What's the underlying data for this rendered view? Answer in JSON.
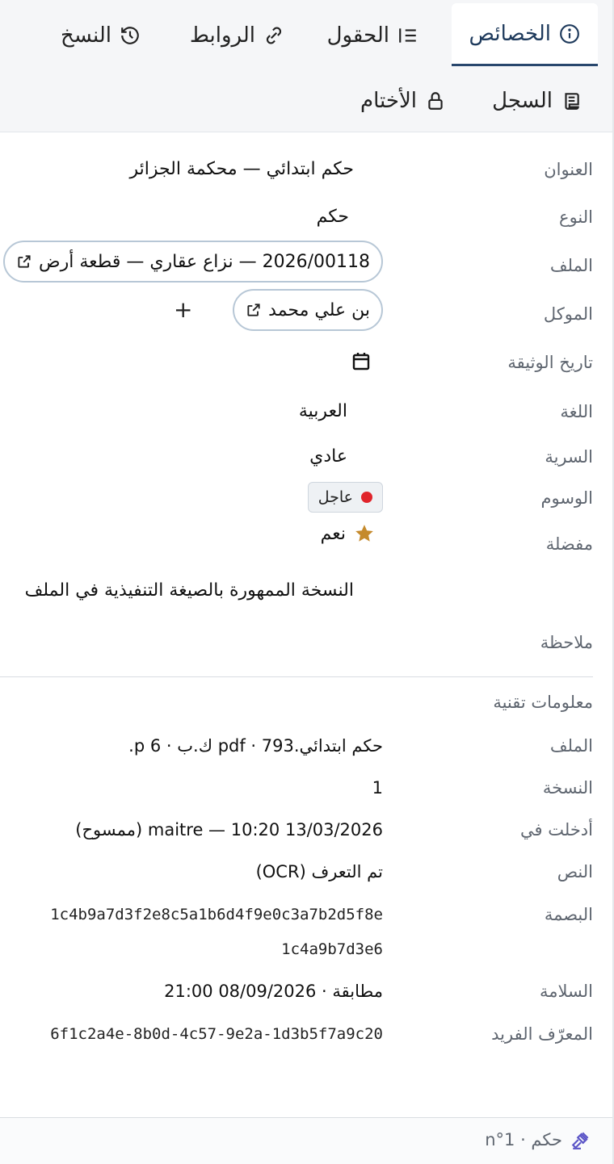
{
  "tabs": {
    "properties": "الخصائص",
    "fields": "الحقول",
    "links": "الروابط",
    "versions": "النسخ",
    "log": "السجل",
    "seals": "الأختام"
  },
  "props": {
    "title_label": "العنوان",
    "title_value": "حكم ابتدائي — محكمة الجزائر",
    "type_label": "النوع",
    "type_value": "حكم",
    "file_label": "الملف",
    "file_chip": "2026/00118 — نزاع عقاري — قطعة أرض",
    "client_label": "الموكل",
    "client_chip": "بن علي محمد",
    "add_symbol": "+",
    "date_label": "تاريخ الوثيقة",
    "language_label": "اللغة",
    "language_value": "العربية",
    "confidentiality_label": "السرية",
    "confidentiality_value": "عادي",
    "tags_label": "الوسوم",
    "tag_urgent": "عاجل",
    "favorite_label": "مفضلة",
    "favorite_value": "نعم",
    "note_label": "ملاحظة",
    "note_value": "النسخة الممهورة بالصيغة التنفيذية في الملف"
  },
  "tech": {
    "section_title": "معلومات تقنية",
    "file_label": "الملف",
    "file_value": "حكم ابتدائي.pdf · 793 ك.ب · 6 p.",
    "version_label": "النسخة",
    "version_value": "1",
    "entered_label": "أدخلت في",
    "entered_value": "13/03/2026 10:20 — maitre (ممسوح)",
    "text_label": "النص",
    "text_value": "تم التعرف (OCR)",
    "fingerprint_label": "البصمة",
    "fingerprint_line1": "1c4b9a7d3f2e8c5a1b6d4f9e0c3a7b2d5f8e",
    "fingerprint_line2": "1c4a9b7d3e6",
    "integrity_label": "السلامة",
    "integrity_value": "مطابقة · 08/09/2026 21:00",
    "uid_label": "المعرّف الفريد",
    "uid_value": "6f1c2a4e-8b0d-4c57-9e2a-1d3b5f7a9c20"
  },
  "footer": {
    "text": "حكم · n°1"
  },
  "colors": {
    "accent": "#28476d",
    "tag_dot": "#e0242b",
    "star": "#c58a2c",
    "footer_icon": "#5b55c7"
  }
}
